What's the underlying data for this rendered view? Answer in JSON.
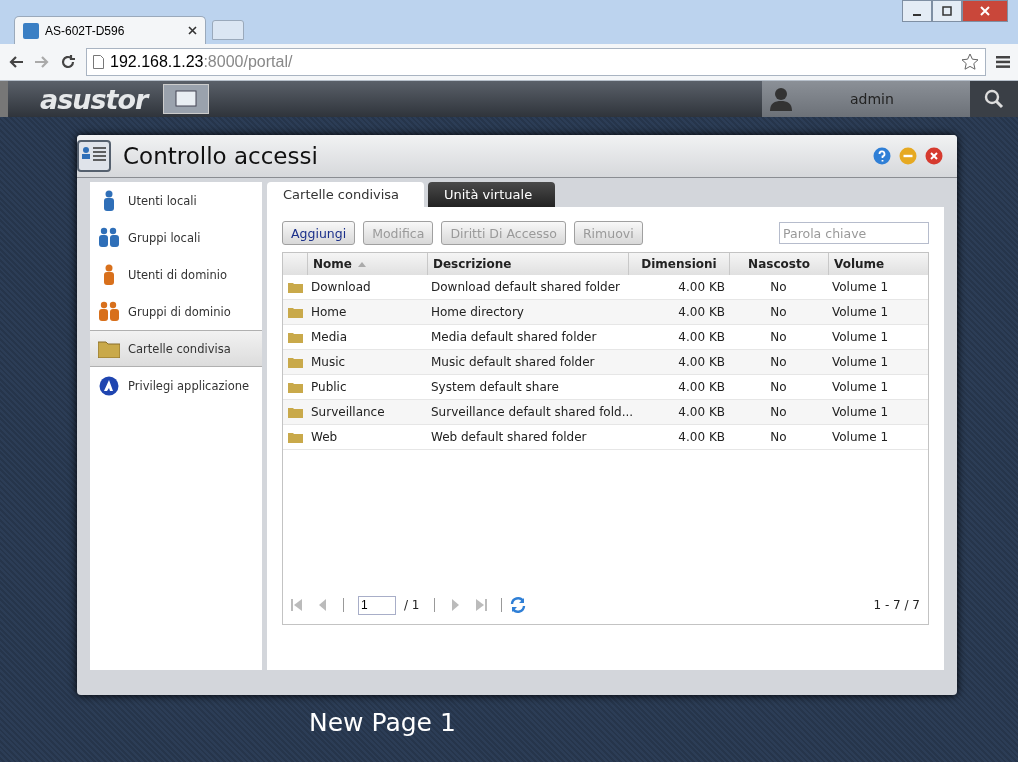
{
  "browser": {
    "tab_title": "AS-602T-D596",
    "url_host": "192.168.1.23",
    "url_rest": ":8000/portal/"
  },
  "topbar": {
    "logo": "asustor",
    "user": "admin"
  },
  "window": {
    "title": "Controllo accessi"
  },
  "sidebar": {
    "items": [
      {
        "label": "Utenti locali",
        "kind": "user",
        "color": "#2f6fb8",
        "selected": false
      },
      {
        "label": "Gruppi locali",
        "kind": "group",
        "color": "#2f6fb8",
        "selected": false
      },
      {
        "label": "Utenti di dominio",
        "kind": "user",
        "color": "#d8701c",
        "selected": false
      },
      {
        "label": "Gruppi di dominio",
        "kind": "group",
        "color": "#d8701c",
        "selected": false
      },
      {
        "label": "Cartelle condivisa",
        "kind": "folder",
        "color": "#c9a94a",
        "selected": true
      },
      {
        "label": "Privilegi applicazione",
        "kind": "app",
        "color": "#1f45b0",
        "selected": false
      }
    ]
  },
  "tabs": [
    {
      "label": "Cartelle condivisa",
      "selected": true
    },
    {
      "label": "Unità virtuale",
      "selected": false
    }
  ],
  "toolbar": {
    "buttons": [
      {
        "label": "Aggiungi",
        "disabled": false
      },
      {
        "label": "Modifica",
        "disabled": true
      },
      {
        "label": "Diritti Di Accesso",
        "disabled": true
      },
      {
        "label": "Rimuovi",
        "disabled": true
      }
    ],
    "search": {
      "placeholder": "Parola chiave"
    }
  },
  "table": {
    "columns": [
      {
        "label": "Nome",
        "sorted": true
      },
      {
        "label": "Descrizione",
        "sorted": false
      },
      {
        "label": "Dimensioni",
        "sorted": false
      },
      {
        "label": "Nascosto",
        "sorted": false
      },
      {
        "label": "Volume",
        "sorted": false
      }
    ],
    "rows": [
      [
        "Download",
        "Download default shared folder",
        "4.00 KB",
        "No",
        "Volume 1"
      ],
      [
        "Home",
        "Home directory",
        "4.00 KB",
        "No",
        "Volume 1"
      ],
      [
        "Media",
        "Media default shared folder",
        "4.00 KB",
        "No",
        "Volume 1"
      ],
      [
        "Music",
        "Music default shared folder",
        "4.00 KB",
        "No",
        "Volume 1"
      ],
      [
        "Public",
        "System default share",
        "4.00 KB",
        "No",
        "Volume 1"
      ],
      [
        "Surveillance",
        "Surveillance default shared fold...",
        "4.00 KB",
        "No",
        "Volume 1"
      ],
      [
        "Web",
        "Web default shared folder",
        "4.00 KB",
        "No",
        "Volume 1"
      ]
    ]
  },
  "pager": {
    "page": "1",
    "of": "/ 1",
    "summary": "1 - 7 / 7"
  },
  "desktop": {
    "caption": "New Page 1"
  }
}
